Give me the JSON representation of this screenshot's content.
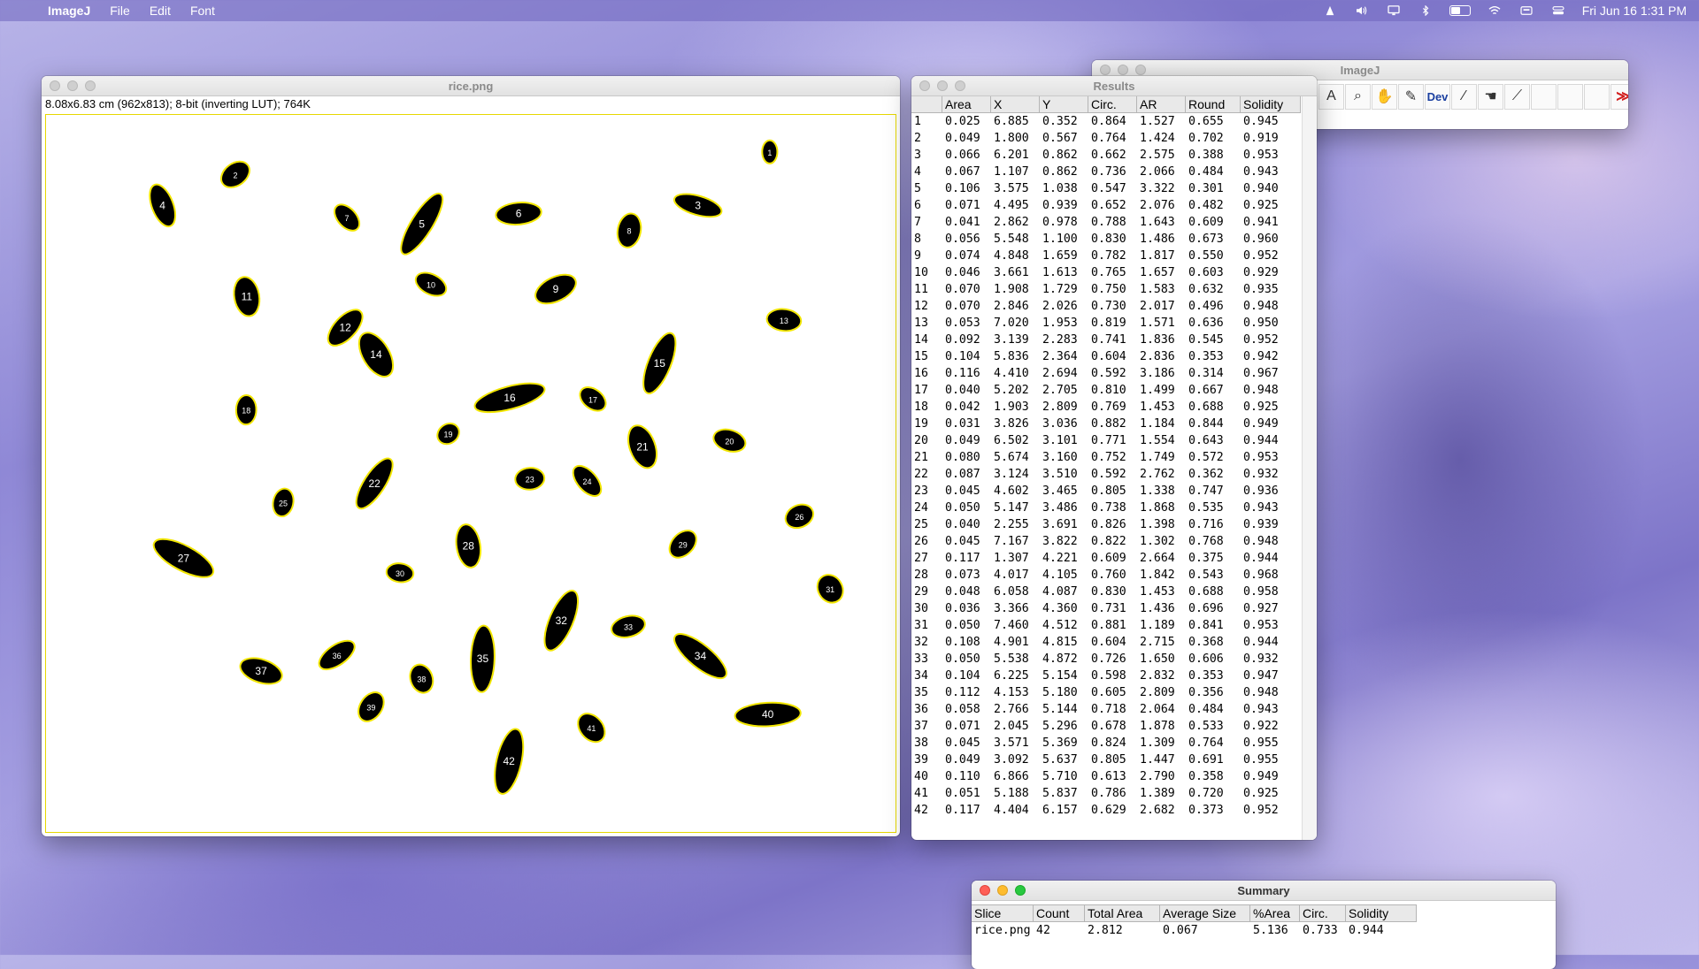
{
  "menubar": {
    "app_name": "ImageJ",
    "items": [
      "File",
      "Edit",
      "Font"
    ],
    "clock": "Fri Jun 16  1:31 PM"
  },
  "image_window": {
    "title": "rice.png",
    "info": "8.08x6.83 cm (962x813); 8-bit (inverting LUT); 764K"
  },
  "results_window": {
    "title": "Results",
    "columns": [
      "",
      "Area",
      "X",
      "Y",
      "Circ.",
      "AR",
      "Round",
      "Solidity"
    ],
    "rows": [
      [
        "1",
        "0.025",
        "6.885",
        "0.352",
        "0.864",
        "1.527",
        "0.655",
        "0.945"
      ],
      [
        "2",
        "0.049",
        "1.800",
        "0.567",
        "0.764",
        "1.424",
        "0.702",
        "0.919"
      ],
      [
        "3",
        "0.066",
        "6.201",
        "0.862",
        "0.662",
        "2.575",
        "0.388",
        "0.953"
      ],
      [
        "4",
        "0.067",
        "1.107",
        "0.862",
        "0.736",
        "2.066",
        "0.484",
        "0.943"
      ],
      [
        "5",
        "0.106",
        "3.575",
        "1.038",
        "0.547",
        "3.322",
        "0.301",
        "0.940"
      ],
      [
        "6",
        "0.071",
        "4.495",
        "0.939",
        "0.652",
        "2.076",
        "0.482",
        "0.925"
      ],
      [
        "7",
        "0.041",
        "2.862",
        "0.978",
        "0.788",
        "1.643",
        "0.609",
        "0.941"
      ],
      [
        "8",
        "0.056",
        "5.548",
        "1.100",
        "0.830",
        "1.486",
        "0.673",
        "0.960"
      ],
      [
        "9",
        "0.074",
        "4.848",
        "1.659",
        "0.782",
        "1.817",
        "0.550",
        "0.952"
      ],
      [
        "10",
        "0.046",
        "3.661",
        "1.613",
        "0.765",
        "1.657",
        "0.603",
        "0.929"
      ],
      [
        "11",
        "0.070",
        "1.908",
        "1.729",
        "0.750",
        "1.583",
        "0.632",
        "0.935"
      ],
      [
        "12",
        "0.070",
        "2.846",
        "2.026",
        "0.730",
        "2.017",
        "0.496",
        "0.948"
      ],
      [
        "13",
        "0.053",
        "7.020",
        "1.953",
        "0.819",
        "1.571",
        "0.636",
        "0.950"
      ],
      [
        "14",
        "0.092",
        "3.139",
        "2.283",
        "0.741",
        "1.836",
        "0.545",
        "0.952"
      ],
      [
        "15",
        "0.104",
        "5.836",
        "2.364",
        "0.604",
        "2.836",
        "0.353",
        "0.942"
      ],
      [
        "16",
        "0.116",
        "4.410",
        "2.694",
        "0.592",
        "3.186",
        "0.314",
        "0.967"
      ],
      [
        "17",
        "0.040",
        "5.202",
        "2.705",
        "0.810",
        "1.499",
        "0.667",
        "0.948"
      ],
      [
        "18",
        "0.042",
        "1.903",
        "2.809",
        "0.769",
        "1.453",
        "0.688",
        "0.925"
      ],
      [
        "19",
        "0.031",
        "3.826",
        "3.036",
        "0.882",
        "1.184",
        "0.844",
        "0.949"
      ],
      [
        "20",
        "0.049",
        "6.502",
        "3.101",
        "0.771",
        "1.554",
        "0.643",
        "0.944"
      ],
      [
        "21",
        "0.080",
        "5.674",
        "3.160",
        "0.752",
        "1.749",
        "0.572",
        "0.953"
      ],
      [
        "22",
        "0.087",
        "3.124",
        "3.510",
        "0.592",
        "2.762",
        "0.362",
        "0.932"
      ],
      [
        "23",
        "0.045",
        "4.602",
        "3.465",
        "0.805",
        "1.338",
        "0.747",
        "0.936"
      ],
      [
        "24",
        "0.050",
        "5.147",
        "3.486",
        "0.738",
        "1.868",
        "0.535",
        "0.943"
      ],
      [
        "25",
        "0.040",
        "2.255",
        "3.691",
        "0.826",
        "1.398",
        "0.716",
        "0.939"
      ],
      [
        "26",
        "0.045",
        "7.167",
        "3.822",
        "0.822",
        "1.302",
        "0.768",
        "0.948"
      ],
      [
        "27",
        "0.117",
        "1.307",
        "4.221",
        "0.609",
        "2.664",
        "0.375",
        "0.944"
      ],
      [
        "28",
        "0.073",
        "4.017",
        "4.105",
        "0.760",
        "1.842",
        "0.543",
        "0.968"
      ],
      [
        "29",
        "0.048",
        "6.058",
        "4.087",
        "0.830",
        "1.453",
        "0.688",
        "0.958"
      ],
      [
        "30",
        "0.036",
        "3.366",
        "4.360",
        "0.731",
        "1.436",
        "0.696",
        "0.927"
      ],
      [
        "31",
        "0.050",
        "7.460",
        "4.512",
        "0.881",
        "1.189",
        "0.841",
        "0.953"
      ],
      [
        "32",
        "0.108",
        "4.901",
        "4.815",
        "0.604",
        "2.715",
        "0.368",
        "0.944"
      ],
      [
        "33",
        "0.050",
        "5.538",
        "4.872",
        "0.726",
        "1.650",
        "0.606",
        "0.932"
      ],
      [
        "34",
        "0.104",
        "6.225",
        "5.154",
        "0.598",
        "2.832",
        "0.353",
        "0.947"
      ],
      [
        "35",
        "0.112",
        "4.153",
        "5.180",
        "0.605",
        "2.809",
        "0.356",
        "0.948"
      ],
      [
        "36",
        "0.058",
        "2.766",
        "5.144",
        "0.718",
        "2.064",
        "0.484",
        "0.943"
      ],
      [
        "37",
        "0.071",
        "2.045",
        "5.296",
        "0.678",
        "1.878",
        "0.533",
        "0.922"
      ],
      [
        "38",
        "0.045",
        "3.571",
        "5.369",
        "0.824",
        "1.309",
        "0.764",
        "0.955"
      ],
      [
        "39",
        "0.049",
        "3.092",
        "5.637",
        "0.805",
        "1.447",
        "0.691",
        "0.955"
      ],
      [
        "40",
        "0.110",
        "6.866",
        "5.710",
        "0.613",
        "2.790",
        "0.358",
        "0.949"
      ],
      [
        "41",
        "0.051",
        "5.188",
        "5.837",
        "0.786",
        "1.389",
        "0.720",
        "0.925"
      ],
      [
        "42",
        "0.117",
        "4.404",
        "6.157",
        "0.629",
        "2.682",
        "0.373",
        "0.952"
      ]
    ]
  },
  "toolbar_window": {
    "title": "ImageJ",
    "tools": [
      {
        "icon": "text-tool-icon",
        "glyph": "A"
      },
      {
        "icon": "magnifier-icon",
        "glyph": "⌕"
      },
      {
        "icon": "hand-icon",
        "glyph": "✋"
      },
      {
        "icon": "color-picker-icon",
        "glyph": "✎"
      },
      {
        "icon": "developer-menu-icon",
        "glyph": "Dev"
      },
      {
        "icon": "brush-icon",
        "glyph": "⁄"
      },
      {
        "icon": "flood-fill-icon",
        "glyph": "☚"
      },
      {
        "icon": "wand-icon",
        "glyph": "⟋"
      },
      {
        "icon": "empty-slot-icon",
        "glyph": ""
      },
      {
        "icon": "empty-slot-icon",
        "glyph": ""
      },
      {
        "icon": "empty-slot-icon",
        "glyph": ""
      },
      {
        "icon": "more-tools-icon",
        "glyph": "≫"
      }
    ]
  },
  "summary_window": {
    "title": "Summary",
    "columns": [
      "Slice",
      "Count",
      "Total Area",
      "Average Size",
      "%Area",
      "Circ.",
      "Solidity"
    ],
    "row": [
      "rice.png",
      "42",
      "2.812",
      "0.067",
      "5.136",
      "0.733",
      "0.944"
    ]
  },
  "colors": {
    "particle_fill": "#000000",
    "particle_outline": "#f2e600",
    "label_color": "#ffffff"
  }
}
